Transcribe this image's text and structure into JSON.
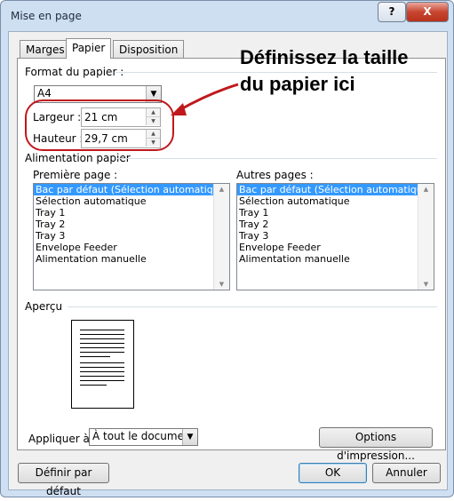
{
  "window": {
    "title": "Mise en page",
    "help_glyph": "?",
    "close_glyph": "X"
  },
  "tabs": [
    "Marges",
    "Papier",
    "Disposition"
  ],
  "active_tab": "Papier",
  "paper_format": {
    "group_label": "Format du papier :",
    "size_value": "A4",
    "width_label": "Largeur :",
    "width_value": "21 cm",
    "height_label": "Hauteur :",
    "height_value": "29,7 cm"
  },
  "paper_source": {
    "group_label": "Alimentation papier",
    "first_page_label": "Première page :",
    "other_pages_label": "Autres pages :",
    "options": [
      "Bac par défaut (Sélection automatique)",
      "Sélection automatique",
      "Tray 1",
      "Tray 2",
      "Tray 3",
      "Envelope Feeder",
      "Alimentation manuelle"
    ],
    "selected_index": 0
  },
  "preview": {
    "label": "Aperçu"
  },
  "apply_to": {
    "label": "Appliquer à :",
    "value": "À tout le document"
  },
  "buttons": {
    "print_options": "Options d'impression...",
    "set_default": "Définir par défaut",
    "ok": "OK",
    "cancel": "Annuler"
  },
  "annotation": {
    "line1": "Définissez la taille",
    "line2": "du papier ici",
    "color": "#c0181c"
  }
}
